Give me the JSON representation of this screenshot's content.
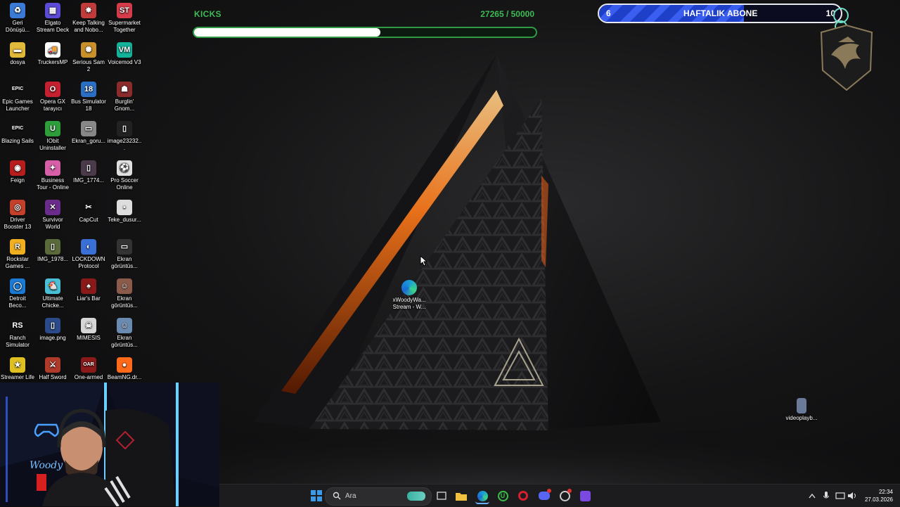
{
  "desktop_icons": [
    {
      "label": "Geri Dönüşü...",
      "color": "#3b7bd6",
      "glyph": "♻"
    },
    {
      "label": "Elgato Stream Deck",
      "color": "#5b4bd6",
      "glyph": "▦"
    },
    {
      "label": "Keep Talking and Nobo...",
      "color": "#c23b3b",
      "glyph": "✸"
    },
    {
      "label": "Supermarket Together",
      "color": "#d63b4a",
      "glyph": "ST"
    },
    {
      "label": "dosya",
      "color": "#e0b83a",
      "glyph": "▬"
    },
    {
      "label": "TruckersMP",
      "color": "#ffffff",
      "glyph": "🚚"
    },
    {
      "label": "Serious Sam 2",
      "color": "#c8902a",
      "glyph": "✺"
    },
    {
      "label": "Voicemod V3",
      "color": "#13b39a",
      "glyph": "VM"
    },
    {
      "label": "Epic Games Launcher",
      "color": "#111111",
      "glyph": "EPIC"
    },
    {
      "label": "Opera GX tarayıcı",
      "color": "#c4202f",
      "glyph": "O"
    },
    {
      "label": "Bus Simulator 18",
      "color": "#2a6fc4",
      "glyph": "18"
    },
    {
      "label": "Burglin' Gnom...",
      "color": "#8a2c2c",
      "glyph": "☗"
    },
    {
      "label": "Blazing Sails",
      "color": "#111111",
      "glyph": "EPIC"
    },
    {
      "label": "IObit Uninstaller",
      "color": "#2e9e3a",
      "glyph": "U"
    },
    {
      "label": "Ekran_goru...",
      "color": "#888888",
      "glyph": "▭"
    },
    {
      "label": "image23232...",
      "color": "#222222",
      "glyph": "▯"
    },
    {
      "label": "Feign",
      "color": "#b81d1d",
      "glyph": "◉"
    },
    {
      "label": "Business Tour - Online M...",
      "color": "#d65fa8",
      "glyph": "✦"
    },
    {
      "label": "IMG_1774...",
      "color": "#4a3a4a",
      "glyph": "▯"
    },
    {
      "label": "Pro Soccer Online",
      "color": "#e0e0e0",
      "glyph": "⚽"
    },
    {
      "label": "Driver Booster 13",
      "color": "#c4402a",
      "glyph": "◎"
    },
    {
      "label": "Survivor World",
      "color": "#6a2c8a",
      "glyph": "✕"
    },
    {
      "label": "CapCut",
      "color": "#111111",
      "glyph": "✂"
    },
    {
      "label": "Teke_dusur...",
      "color": "#dddddd",
      "glyph": "▪"
    },
    {
      "label": "Rockstar Games ...",
      "color": "#f0b020",
      "glyph": "R"
    },
    {
      "label": "IMG_1978...",
      "color": "#5a6a3a",
      "glyph": "▯"
    },
    {
      "label": "LOCKDOWN Protocol",
      "color": "#3a6fd6",
      "glyph": "◐"
    },
    {
      "label": "Ekran görüntüs...",
      "color": "#333333",
      "glyph": "▭"
    },
    {
      "label": "Detroit Beco...",
      "color": "#1a7ad6",
      "glyph": "◯"
    },
    {
      "label": "Ultimate Chicke...",
      "color": "#4ac0d6",
      "glyph": "🐔"
    },
    {
      "label": "Liar's Bar",
      "color": "#8a1a1a",
      "glyph": "♠"
    },
    {
      "label": "Ekran görüntüs...",
      "color": "#8a5a4a",
      "glyph": "☺"
    },
    {
      "label": "Ranch Simulator",
      "color": "#111111",
      "glyph": "RS"
    },
    {
      "label": "image.png",
      "color": "#2a4a8a",
      "glyph": "▯"
    },
    {
      "label": "MIMESIS",
      "color": "#d6d6d6",
      "glyph": "☠"
    },
    {
      "label": "Ekran görüntüs...",
      "color": "#6a8ab0",
      "glyph": "☺"
    },
    {
      "label": "Streamer Life",
      "color": "#e0c020",
      "glyph": "★"
    },
    {
      "label": "Half Sword",
      "color": "#b03a2a",
      "glyph": "⚔"
    },
    {
      "label": "One-armed",
      "color": "#8a1a1a",
      "glyph": "OAR"
    },
    {
      "label": "BeamNG.dr...",
      "color": "#ff6a1a",
      "glyph": "●"
    }
  ],
  "kicks": {
    "title": "KICKS",
    "count": "27265 / 50000",
    "progress": 0.5453
  },
  "subscribers": {
    "current": "6",
    "title": "HAFTALIK ABONE",
    "goal": "10",
    "progress": 0.6
  },
  "center_shortcut": {
    "label": "xWoodyWa... Stream - W...",
    "color": "#1aa0d6"
  },
  "right_shortcut": {
    "label": "videoplayb..."
  },
  "taskbar": {
    "search_placeholder": "Ara",
    "clock_time": "22:34",
    "clock_date": "27.03.2026"
  },
  "webcam": {
    "neon_text": "Woody"
  }
}
